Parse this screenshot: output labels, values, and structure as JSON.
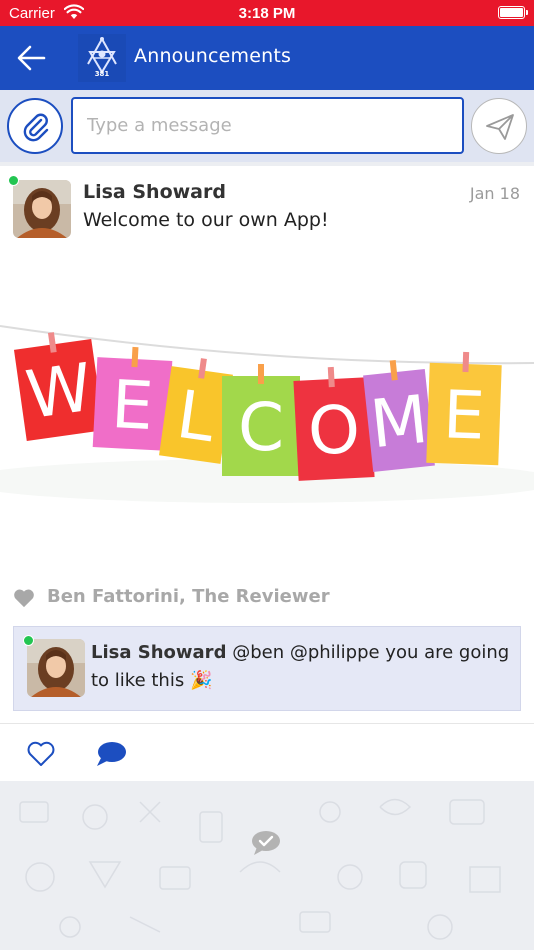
{
  "status_bar": {
    "carrier": "Carrier",
    "time": "3:18 PM"
  },
  "nav": {
    "title": "Announcements",
    "logo_text": "381"
  },
  "composer": {
    "placeholder": "Type a message"
  },
  "post": {
    "author": "Lisa Showard",
    "date": "Jan 18",
    "text": "Welcome to our own App!",
    "banner_letters": [
      "W",
      "E",
      "L",
      "C",
      "O",
      "M",
      "E"
    ],
    "banner_colors": [
      "#ef2e2e",
      "#f06ec8",
      "#f9c52b",
      "#a2d84b",
      "#ee3340",
      "#c77cd8",
      "#fbc73c"
    ],
    "likes": "Ben Fattorini, The Reviewer",
    "comment": {
      "author": "Lisa Showard",
      "text": "@ben @philippe you are going to like this 🎉"
    }
  },
  "colors": {
    "brand": "#1c4ec0",
    "status_bar": "#e8172b",
    "online": "#23c552"
  }
}
